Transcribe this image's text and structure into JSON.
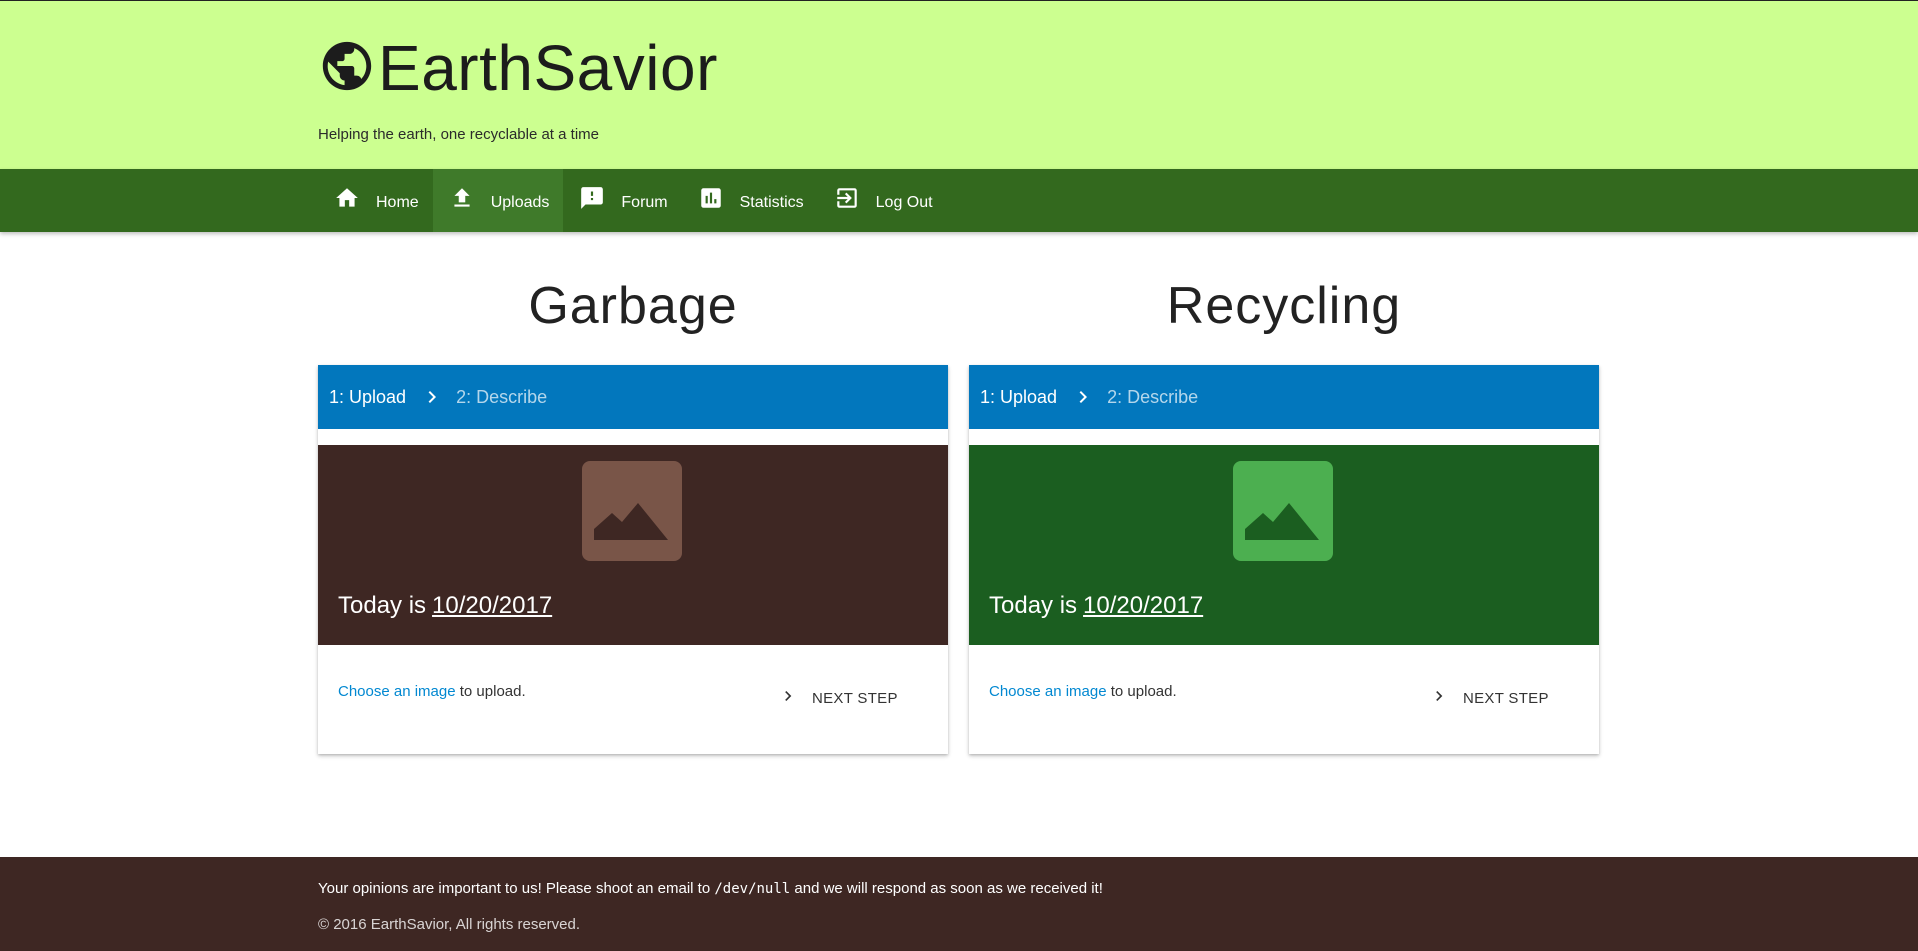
{
  "header": {
    "brand_name": "EarthSavior",
    "tagline": "Helping the earth, one recyclable at a time",
    "icon": "globe-icon",
    "background_color": "#ccff90"
  },
  "nav": {
    "background_color": "#33691e",
    "items": [
      {
        "label": "Home",
        "icon": "home-icon",
        "active": false
      },
      {
        "label": "Uploads",
        "icon": "upload-icon",
        "active": true
      },
      {
        "label": "Forum",
        "icon": "feedback-icon",
        "active": false
      },
      {
        "label": "Statistics",
        "icon": "bar-chart-icon",
        "active": false
      },
      {
        "label": "Log Out",
        "icon": "exit-icon",
        "active": false
      }
    ]
  },
  "garbage": {
    "title": "Garbage",
    "steps": [
      "1: Upload",
      "2: Describe"
    ],
    "today_prefix": "Today is",
    "date": "10/20/2017",
    "choose_link": "Choose an image",
    "choose_suffix": "to upload.",
    "next_label": "NEXT STEP",
    "media_color": "#3e2723",
    "image_box_color": "#795548",
    "stepper_color": "#0277bd"
  },
  "recycling": {
    "title": "Recycling",
    "steps": [
      "1: Upload",
      "2: Describe"
    ],
    "today_prefix": "Today is",
    "date": "10/20/2017",
    "choose_link": "Choose an image",
    "choose_suffix": "to upload.",
    "next_label": "NEXT STEP",
    "media_color": "#1b5e20",
    "image_box_color": "#4caf50",
    "stepper_color": "#0277bd"
  },
  "footer": {
    "message_before": "Your opinions are important to us! Please shoot an email to",
    "message_code": "/dev/null",
    "message_after": "and we will respond as soon as we received it!",
    "copyright": "© 2016 EarthSavior, All rights reserved.",
    "background_color": "#3e2723"
  }
}
